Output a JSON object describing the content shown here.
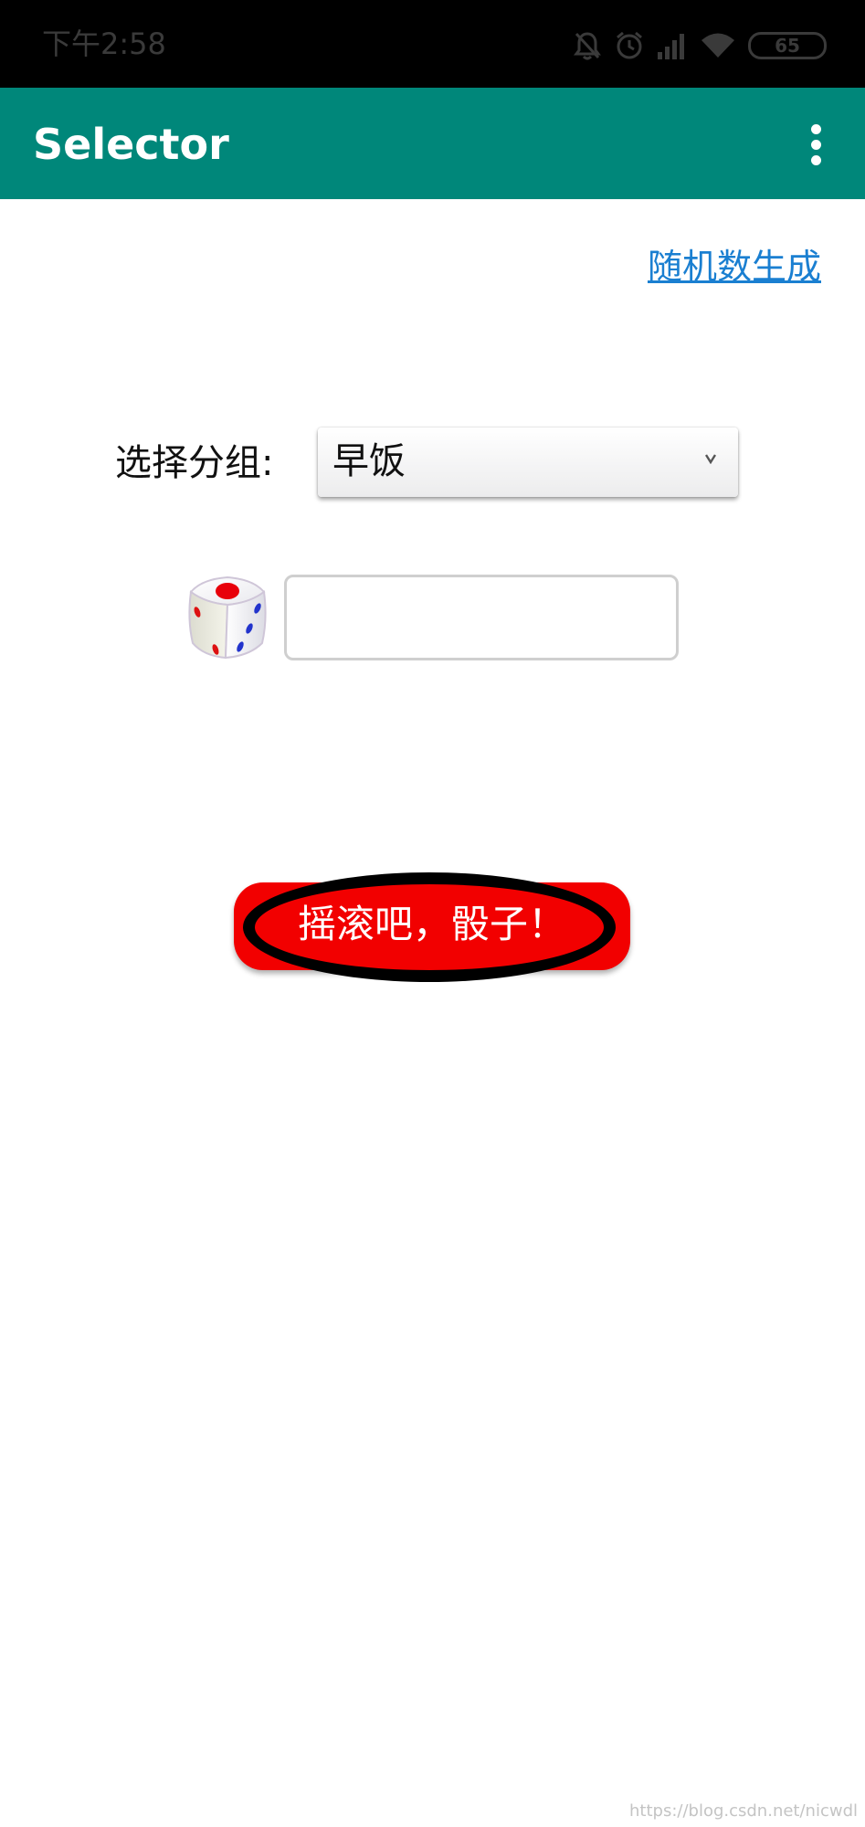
{
  "status_bar": {
    "time": "下午2:58",
    "battery_level": "65",
    "icons": [
      "notifications-off-icon",
      "alarm-icon",
      "signal-icon",
      "wifi-icon",
      "battery-icon"
    ]
  },
  "app_bar": {
    "title": "Selector",
    "menu_icon": "more-vert-icon",
    "color": "#00877a"
  },
  "main": {
    "random_link": "随机数生成",
    "group_label": "选择分组:",
    "group_select": {
      "selected": "早饭",
      "icon": "chevron-down-icon"
    },
    "dice_icon": "dice-icon",
    "result_value": "",
    "roll_button": {
      "label": "摇滚吧，骰子！",
      "color": "#f20000",
      "ring_color": "#000000"
    }
  },
  "watermark": "https://blog.csdn.net/nicwdl",
  "colors": {
    "link": "#1a7fd1",
    "status_bar_bg": "#000000"
  }
}
